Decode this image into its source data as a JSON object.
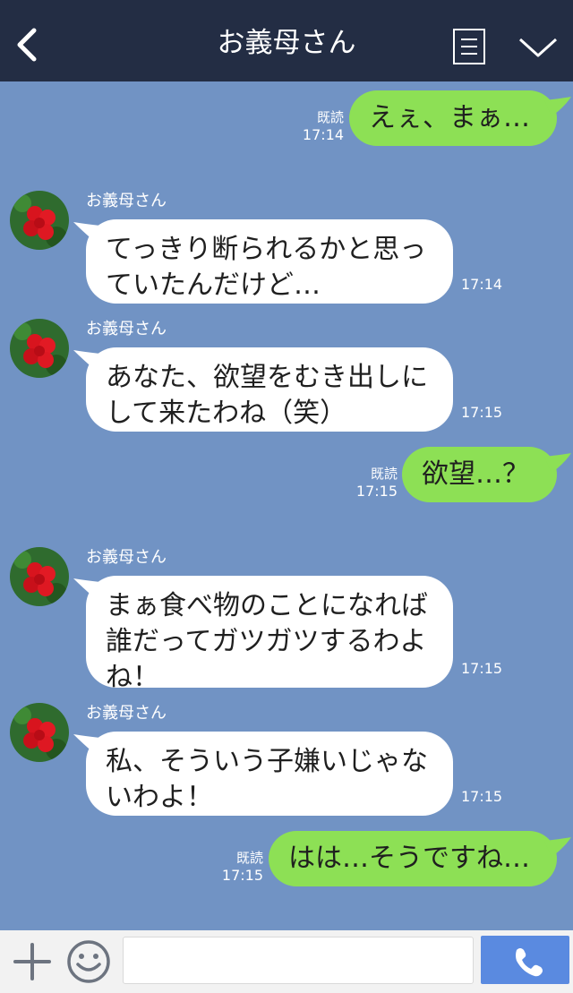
{
  "header": {
    "title": "お義母さん",
    "back_icon": "chevron-left-icon",
    "menu_icon": "list-icon",
    "collapse_icon": "chevron-down-icon"
  },
  "messages": [
    {
      "side": "right",
      "text": "えぇ、まぁ…",
      "read": "既読",
      "time": "17:14"
    },
    {
      "side": "left",
      "sender": "お義母さん",
      "lines": [
        "てっきり断られるかと思っ",
        "ていたんだけど…"
      ],
      "time": "17:14"
    },
    {
      "side": "left",
      "sender": "お義母さん",
      "lines": [
        "あなた、欲望をむき出しに",
        "して来たわね（笑）"
      ],
      "time": "17:15"
    },
    {
      "side": "right",
      "text": "欲望…？",
      "read": "既読",
      "time": "17:15"
    },
    {
      "side": "left",
      "sender": "お義母さん",
      "lines": [
        "まぁ食べ物のことになれば",
        "誰だってガツガツするわよ",
        "ね！"
      ],
      "time": "17:15"
    },
    {
      "side": "left",
      "sender": "お義母さん",
      "lines": [
        "私、そういう子嫌いじゃな",
        "いわよ！"
      ],
      "time": "17:15"
    },
    {
      "side": "right",
      "text": "はは…そうですね…",
      "read": "既読",
      "time": "17:15"
    }
  ],
  "footer": {
    "plus_icon": "plus-icon",
    "emoji_icon": "smiley-icon",
    "input_value": "",
    "send_icon": "phone-icon"
  },
  "colors": {
    "background": "#7193c4",
    "header": "#232d44",
    "my_bubble": "#8de055",
    "their_bubble": "#ffffff",
    "send_button": "#5a8ae0"
  }
}
